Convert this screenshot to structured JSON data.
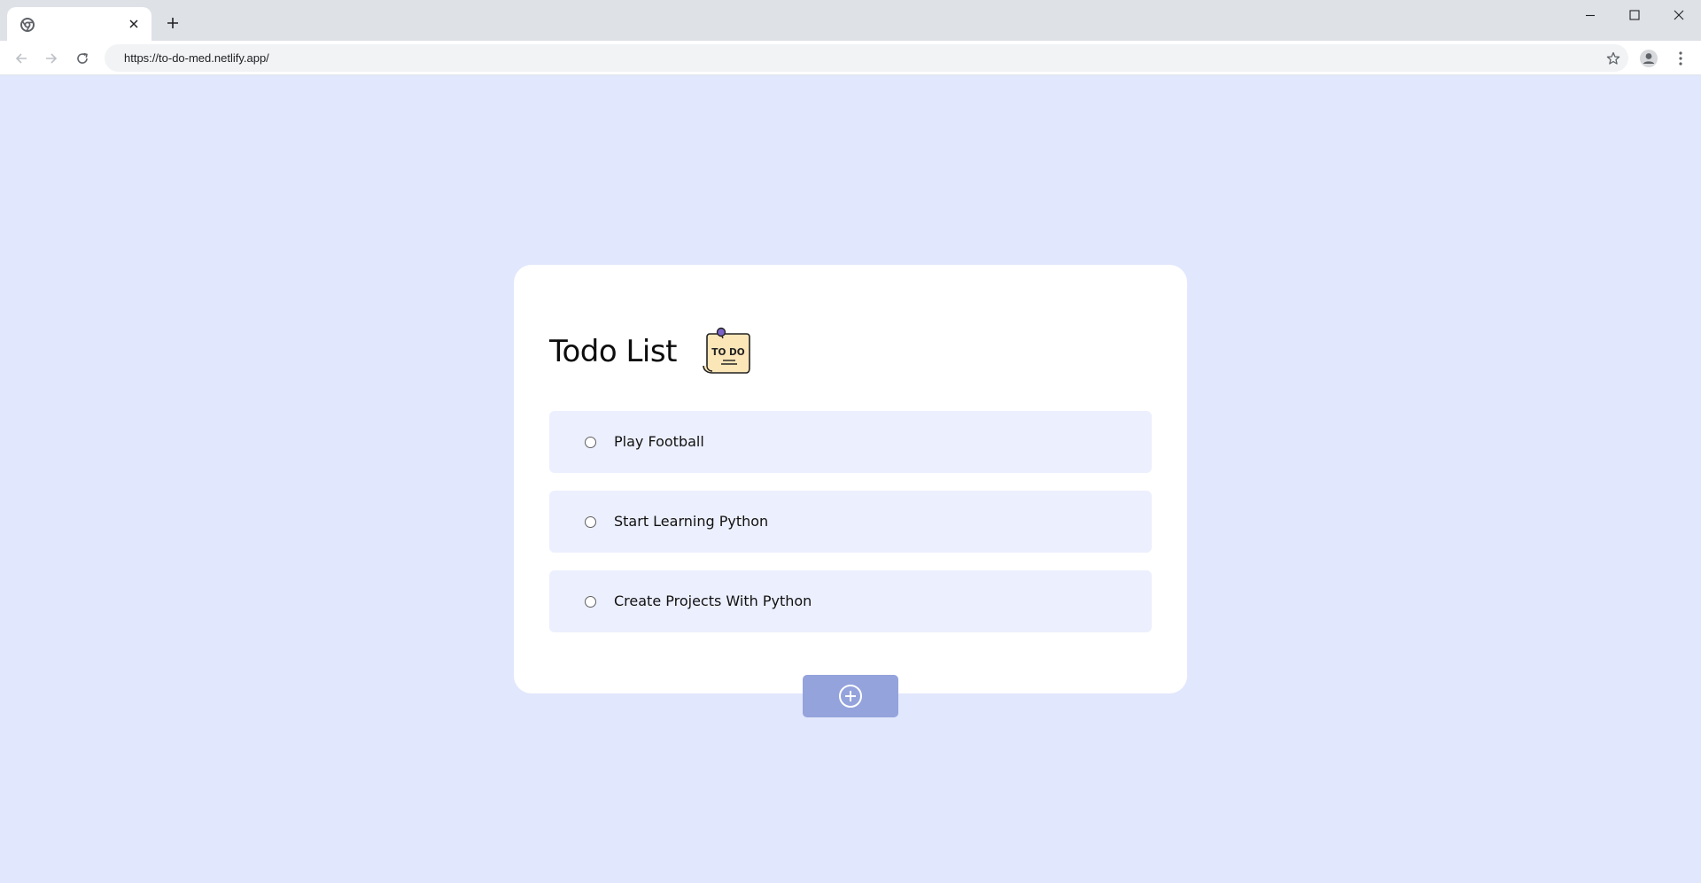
{
  "browser": {
    "tab": {
      "title": "",
      "favicon_icon": "chrome-icon",
      "close_icon": "close-icon"
    },
    "new_tab_icon": "plus-icon",
    "window_controls": [
      "minimize-icon",
      "maximize-icon",
      "close-icon"
    ],
    "nav": [
      "back-arrow-icon",
      "forward-arrow-icon",
      "reload-icon"
    ],
    "url": "https://to-do-med.netlify.app/",
    "bookmark_icon": "star-icon",
    "profile_icon": "profile-icon",
    "menu_icon": "kebab-menu-icon"
  },
  "app": {
    "title": "Todo List",
    "logo_text": "TO DO",
    "tasks": [
      {
        "label": "Play Football",
        "done": false
      },
      {
        "label": "Start Learning Python",
        "done": false
      },
      {
        "label": "Create Projects With Python",
        "done": false
      }
    ],
    "add_button_icon": "plus-circle-icon"
  },
  "colors": {
    "page_bg": "#e1e7fc",
    "card_bg": "#ffffff",
    "task_bg": "#eceffd",
    "add_button_bg": "#94a3dc",
    "logo_paper": "#fbe6b8",
    "logo_pin": "#7b63c6"
  }
}
